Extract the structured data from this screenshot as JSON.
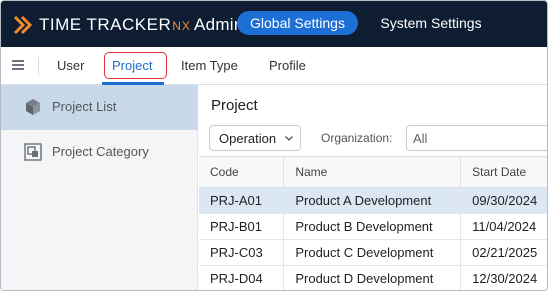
{
  "header": {
    "logo_text": "TIME TRACKER",
    "logo_nx": "NX",
    "logo_admin": "Admin",
    "global_settings_label": "Global Settings",
    "system_settings_label": "System Settings",
    "accent_color": "#1d6fd6",
    "brand_orange": "#ef8a2a"
  },
  "tabs": [
    {
      "label": "User"
    },
    {
      "label": "Project",
      "active": true
    },
    {
      "label": "Item Type"
    },
    {
      "label": "Profile"
    }
  ],
  "sidebar": {
    "items": [
      {
        "label": "Project List",
        "icon": "cube-icon",
        "active": true
      },
      {
        "label": "Project Category",
        "icon": "category-icon"
      }
    ]
  },
  "main": {
    "title": "Project",
    "operation_select": "Operation",
    "organization_label": "Organization:",
    "organization_placeholder": "All",
    "table": {
      "columns": [
        "Code",
        "Name",
        "Start Date"
      ],
      "rows": [
        {
          "code": "PRJ-A01",
          "name": "Product A Development",
          "start": "09/30/2024",
          "selected": true
        },
        {
          "code": "PRJ-B01",
          "name": "Product B Development",
          "start": "11/04/2024"
        },
        {
          "code": "PRJ-C03",
          "name": "Product C Development",
          "start": "02/21/2025"
        },
        {
          "code": "PRJ-D04",
          "name": "Product D Development",
          "start": "12/30/2024"
        }
      ]
    }
  }
}
